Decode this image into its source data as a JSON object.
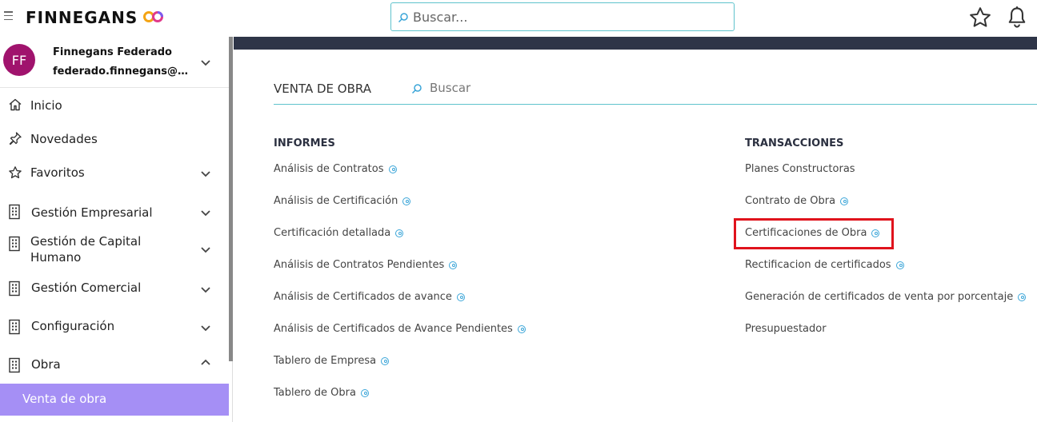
{
  "topbar": {
    "logo_text": "FINNEGANS",
    "search_placeholder": "Buscar..."
  },
  "user": {
    "initials": "FF",
    "name": "Finnegans Federado",
    "email": "federado.finnegans@fin..."
  },
  "sidebar": {
    "items": [
      {
        "label": "Inicio",
        "icon": "home-icon"
      },
      {
        "label": "Novedades",
        "icon": "pin-icon"
      },
      {
        "label": "Favoritos",
        "icon": "star-icon"
      },
      {
        "label": "Gestión Empresarial",
        "icon": "building-icon"
      },
      {
        "label": "Gestión de Capital Humano",
        "icon": "building-icon"
      },
      {
        "label": "Gestión Comercial",
        "icon": "building-icon"
      },
      {
        "label": "Configuración",
        "icon": "building-icon"
      },
      {
        "label": "Obra",
        "icon": "building-icon"
      }
    ],
    "active_sub": "Venta de obra"
  },
  "main": {
    "section_title": "VENTA DE OBRA",
    "search_placeholder": "Buscar",
    "informes": {
      "title": "INFORMES",
      "items": [
        "Análisis de Contratos",
        "Análisis de Certificación",
        "Certificación detallada",
        "Análisis de Contratos Pendientes",
        "Análisis de Certificados de avance",
        "Análisis de Certificados de Avance Pendientes",
        "Tablero de Empresa",
        "Tablero de Obra"
      ]
    },
    "transacciones": {
      "title": "TRANSACCIONES",
      "items": [
        "Planes Constructoras",
        "Contrato de Obra",
        "Certificaciones de Obra",
        "Rectificacion de certificados",
        "Generación de certificados de venta por porcentaje",
        "Presupuestador"
      ]
    }
  },
  "colors": {
    "accent_teal": "#5fc3cc",
    "active_purple": "#a58ff5",
    "avatar": "#a0136d",
    "band": "#2e3548",
    "highlight": "#e0131c"
  }
}
